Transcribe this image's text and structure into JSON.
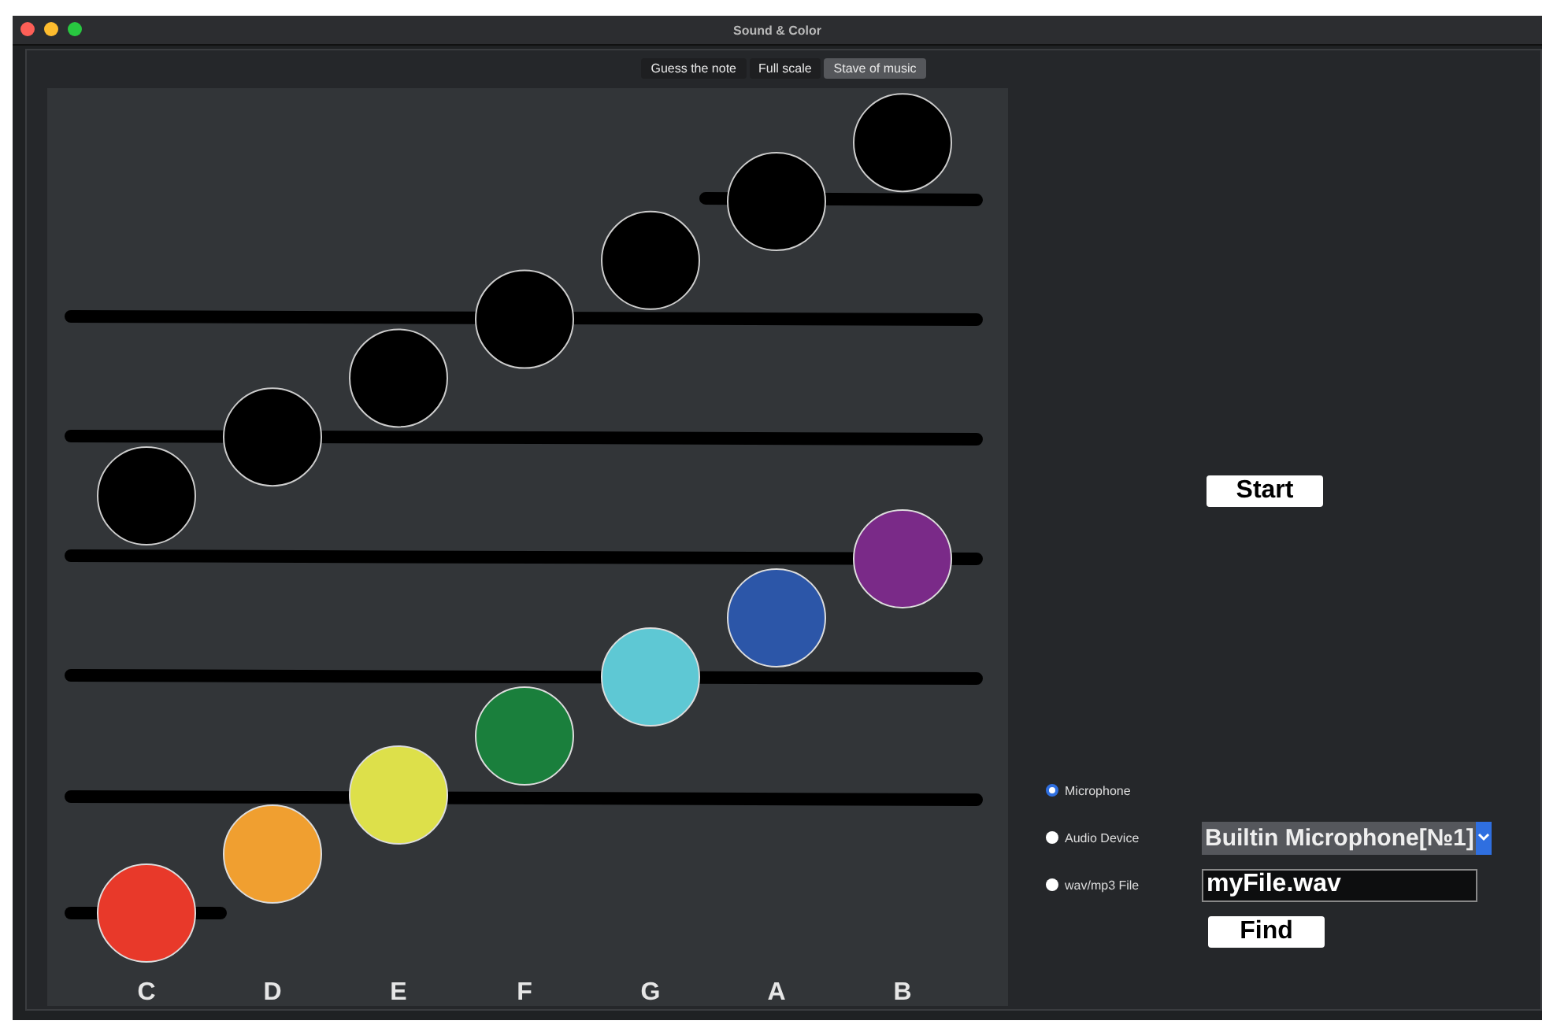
{
  "window": {
    "title": "Sound & Color"
  },
  "tabs": [
    {
      "label": "Guess the note",
      "selected": false
    },
    {
      "label": "Full scale",
      "selected": false
    },
    {
      "label": "Stave of music",
      "selected": true
    }
  ],
  "stave": {
    "notes": [
      {
        "label": "C",
        "color": "#e8392a"
      },
      {
        "label": "D",
        "color": "#f09f30"
      },
      {
        "label": "E",
        "color": "#dde04a"
      },
      {
        "label": "F",
        "color": "#1a7f3c"
      },
      {
        "label": "G",
        "color": "#5ec8d4"
      },
      {
        "label": "A",
        "color": "#2c56a8"
      },
      {
        "label": "B",
        "color": "#7a2a88"
      }
    ]
  },
  "controls": {
    "start_button": "Start",
    "sources": [
      {
        "label": "Microphone",
        "selected": true
      },
      {
        "label": "Audio Device",
        "selected": false
      },
      {
        "label": "wav/mp3 File",
        "selected": false
      }
    ],
    "device": {
      "value": "Builtin Microphone[№1]"
    },
    "file": {
      "value": "myFile.wav"
    },
    "find_button": "Find"
  }
}
